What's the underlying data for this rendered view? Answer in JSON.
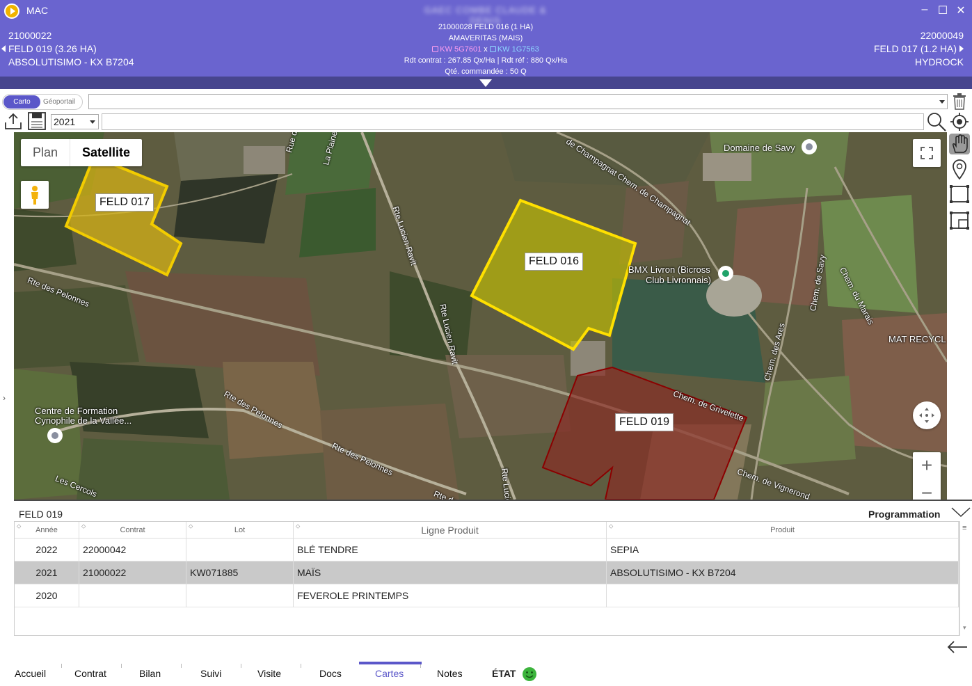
{
  "header": {
    "app_name": "MAC",
    "window_title_blurred": "GAEC COMBE CLAUDE & DENIS",
    "left": {
      "line1": "21000022",
      "line2": "FELD 019 (3.26 HA)",
      "line3": "ABSOLUTISIMO - KX B7204"
    },
    "center": {
      "line1": "21000028 FELD 016 (1 HA)",
      "line2": "AMAVERITAS (MAIS)",
      "kw1": "KW 5G7601",
      "kw_sep": "x",
      "kw2": "KW 1G7563",
      "line4": "Rdt contrat : 267.85 Qx/Ha | Rdt réf : 880 Qx/Ha",
      "line5": "Qté. commandée : 50 Q"
    },
    "right": {
      "line1": "22000049",
      "line2": "FELD 017 (1.2 HA)",
      "line3": "HYDROCK"
    },
    "window_buttons": {
      "minimize": "–",
      "maximize": "☐",
      "close": "✕"
    }
  },
  "toolbar": {
    "seg_carto": "Carto",
    "seg_geoportail": "Géoportail",
    "year": "2021"
  },
  "map": {
    "type_plan": "Plan",
    "type_satellite": "Satellite",
    "fields": [
      {
        "name": "FELD 017",
        "color": "#e8c21a"
      },
      {
        "name": "FELD 016",
        "color": "#f0dd00"
      },
      {
        "name": "FELD 019",
        "color": "#8b1a1a"
      }
    ],
    "places": {
      "domaine": "Domaine de Savy",
      "bmx1": "BMX Livron (Bicross",
      "bmx2": "Club Livronnais)",
      "centre1": "Centre de Formation",
      "centre2": "Cynophile de la Vallée...",
      "mat": "MAT RECYCL"
    },
    "roads": {
      "pelonnes1": "Rte des Pelonnes",
      "pelonnes2": "Rte des Pelonnes",
      "pelonnes3": "Rte des Pelonnes",
      "ravit1": "Rte Lucien Ravit",
      "ravit2": "Rte Lucien Ravit",
      "ravit3": "Rte Lucien",
      "champagnat": "de Champagnat Chem. de Champagnat",
      "savy": "Chem. de Savy",
      "marais": "Chem. du Marais",
      "ares": "Chem. des Ares",
      "grivelette": "Chem. de Grivelette",
      "vignerond": "Chem. de Vignerond",
      "cercols": "Les Cercols",
      "plaine": "La Plaine",
      "rue": "Rue d",
      "rtede": "Rte de"
    },
    "zoom_in": "+",
    "zoom_out": "−"
  },
  "panel": {
    "title": "FELD 019",
    "programmation": "Programmation",
    "columns": [
      "Année",
      "Contrat",
      "Lot",
      "Ligne Produit",
      "Produit"
    ],
    "rows": [
      [
        "2022",
        "22000042",
        "",
        "BLÉ TENDRE",
        "SEPIA"
      ],
      [
        "2021",
        "21000022",
        "KW071885",
        "MAÏS",
        "ABSOLUTISIMO - KX B7204"
      ],
      [
        "2020",
        "",
        "",
        "FEVEROLE PRINTEMPS",
        ""
      ]
    ],
    "selected_row": 1
  },
  "nav": {
    "items": [
      "Accueil",
      "Contrat",
      "Bilan",
      "Suivi",
      "Visite",
      "Docs",
      "Cartes",
      "Notes"
    ],
    "active": "Cartes",
    "etat": "ÉTAT",
    "accent": "#5b57c9"
  }
}
